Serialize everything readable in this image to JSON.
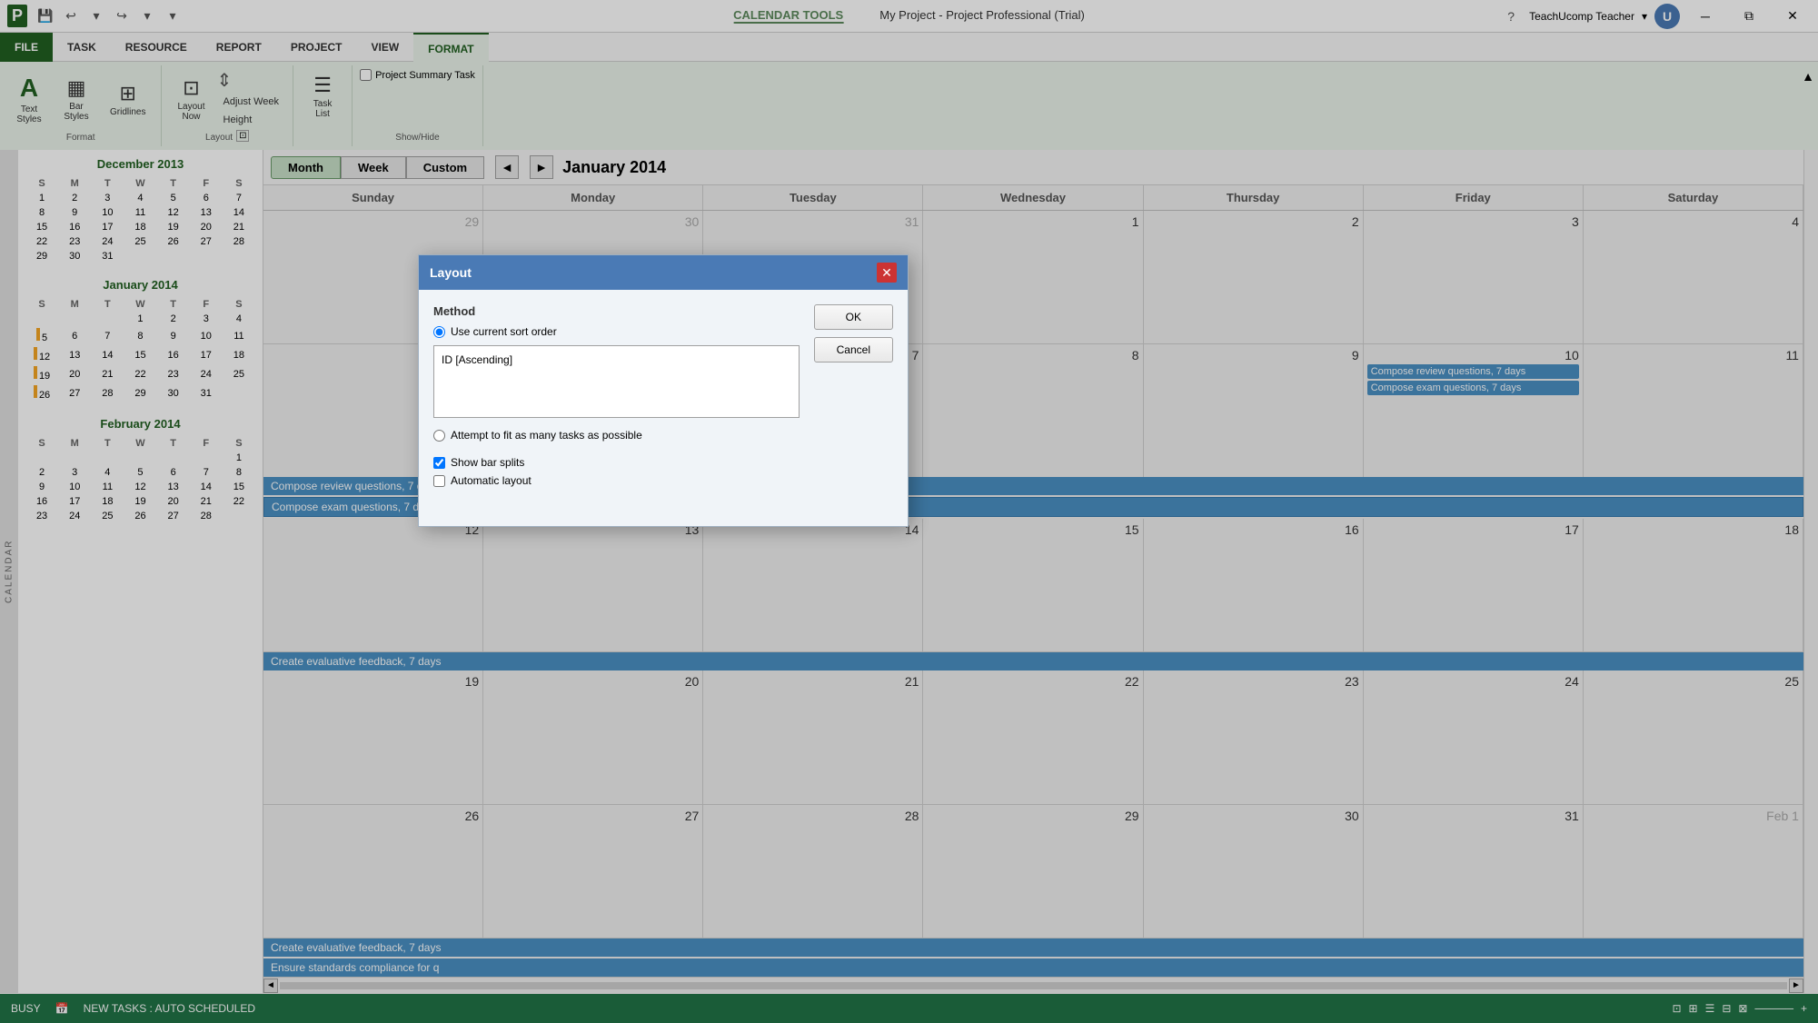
{
  "app": {
    "title": "My Project - Project Professional (Trial)",
    "calendar_tools_tab": "CALENDAR TOOLS"
  },
  "ribbon": {
    "tabs": [
      "FILE",
      "TASK",
      "RESOURCE",
      "REPORT",
      "PROJECT",
      "VIEW",
      "FORMAT"
    ],
    "active_tab": "FORMAT",
    "groups": {
      "format": {
        "label": "Format",
        "buttons": [
          {
            "icon": "A",
            "label": "Text\nStyles"
          },
          {
            "icon": "▦",
            "label": "Bar\nStyles"
          },
          {
            "icon": "⊞",
            "label": "Gridlines"
          }
        ]
      },
      "layout": {
        "label": "Layout",
        "buttons": [
          {
            "icon": "⊡",
            "label": "Layout\nNow"
          },
          {
            "label": "Adjust Week\nHeight"
          }
        ]
      },
      "showhide": {
        "label": "Show/Hide",
        "checkbox": "Project Summary Task"
      }
    }
  },
  "view_toolbar": {
    "buttons": [
      "Month",
      "Week",
      "Custom"
    ],
    "active": "Month",
    "current_month": "January 2014",
    "nav_prev": "◄",
    "nav_next": "►"
  },
  "sidebar": {
    "label": "CALENDAR",
    "calendars": [
      {
        "title": "December 2013",
        "year": 2013,
        "month": 12,
        "weeks": [
          [
            null,
            null,
            null,
            null,
            null,
            null,
            null
          ],
          [
            1,
            2,
            3,
            4,
            5,
            6,
            7
          ],
          [
            8,
            9,
            10,
            11,
            12,
            13,
            14
          ],
          [
            15,
            16,
            17,
            18,
            19,
            20,
            21
          ],
          [
            22,
            23,
            24,
            25,
            26,
            27,
            28
          ],
          [
            29,
            30,
            31,
            null,
            null,
            null,
            null
          ]
        ]
      },
      {
        "title": "January 2014",
        "year": 2014,
        "month": 1,
        "has_yellow": true,
        "weeks": [
          [
            null,
            null,
            null,
            null,
            null,
            null,
            null
          ],
          [
            null,
            null,
            null,
            1,
            2,
            3,
            4
          ],
          [
            5,
            6,
            7,
            8,
            9,
            10,
            11
          ],
          [
            12,
            13,
            14,
            15,
            16,
            17,
            18
          ],
          [
            19,
            20,
            21,
            22,
            23,
            24,
            25
          ],
          [
            26,
            27,
            28,
            29,
            30,
            31,
            null
          ]
        ]
      },
      {
        "title": "February 2014",
        "year": 2014,
        "month": 2,
        "weeks": [
          [
            null,
            null,
            null,
            null,
            null,
            null,
            null
          ],
          [
            null,
            null,
            null,
            null,
            null,
            null,
            1
          ],
          [
            2,
            3,
            4,
            5,
            6,
            7,
            8
          ],
          [
            9,
            10,
            11,
            12,
            13,
            14,
            15
          ],
          [
            16,
            17,
            18,
            19,
            20,
            21,
            22
          ],
          [
            23,
            24,
            25,
            26,
            27,
            28,
            null
          ]
        ]
      }
    ],
    "day_headers": [
      "S",
      "M",
      "T",
      "W",
      "T",
      "F",
      "S"
    ]
  },
  "calendar_main": {
    "day_headers": [
      "Sunday",
      "Monday",
      "Tuesday",
      "Wednesday",
      "Thursday",
      "Friday",
      "Saturday"
    ],
    "weeks": [
      {
        "days": [
          {
            "num": "",
            "events": []
          },
          {
            "num": "",
            "events": []
          },
          {
            "num": "",
            "events": []
          },
          {
            "num": "1",
            "events": []
          },
          {
            "num": "",
            "events": []
          },
          {
            "num": "9",
            "events": [
              "Compose review questions, 7 days",
              "Compose exam questions, 7 days"
            ]
          },
          {
            "num": "10",
            "events": []
          },
          {
            "num": "11",
            "events": []
          }
        ]
      }
    ],
    "events": {
      "week2_row1": "Compose review questions, 7 days",
      "week2_row2": "Compose exam questions, 7 days",
      "week3_row1": "Create evaluative feedback, 7 days",
      "week4_fri": "Create evaluative feedback, 7 days",
      "week4_sat": "Ensure standards compliance for q"
    },
    "day_numbers": {
      "row1": [
        "",
        "",
        "",
        "1",
        "",
        "9",
        "10",
        "11"
      ],
      "row2": [
        "",
        "",
        "",
        "",
        "",
        "16",
        "17",
        "18"
      ],
      "row3": [
        "",
        "",
        "",
        "",
        "",
        "23",
        "24",
        "25"
      ],
      "row4": [
        "26",
        "27",
        "28",
        "29",
        "30",
        "31",
        "Feb 1"
      ]
    }
  },
  "dialog": {
    "title": "Layout",
    "method_label": "Method",
    "radio_current": "Use current sort order",
    "sort_value": "ID [Ascending]",
    "radio_fit": "Attempt to fit as many tasks as possible",
    "checkbox_bar_splits": "Show bar splits",
    "checkbox_auto_layout": "Automatic layout",
    "btn_ok": "OK",
    "btn_cancel": "Cancel",
    "radio_current_checked": true,
    "checkbox_bar_splits_checked": true,
    "checkbox_auto_layout_checked": false
  },
  "status_bar": {
    "status": "BUSY",
    "message": "NEW TASKS : AUTO SCHEDULED"
  },
  "user": {
    "name": "TeachUcomp Teacher",
    "initial": "U"
  },
  "icons": {
    "help": "?",
    "minimize": "─",
    "maximize": "□",
    "close": "✕",
    "prev": "◄",
    "next": "►",
    "undo": "↩",
    "redo": "↪",
    "save": "💾",
    "proj_icon": "P"
  }
}
